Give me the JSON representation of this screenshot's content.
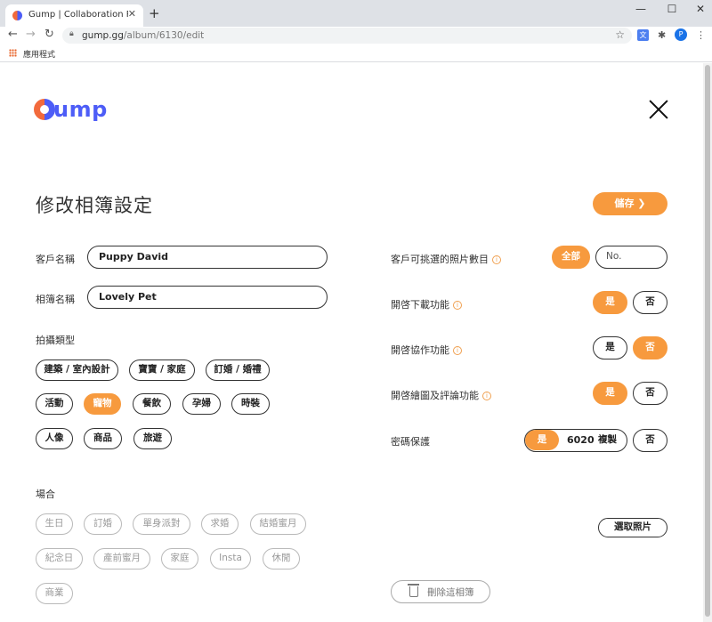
{
  "browser": {
    "tab_title": "Gump | Collaboration Platform",
    "tab_close": "✕",
    "new_tab": "+",
    "url_host": "gump.gg",
    "url_path": "/album/6130/edit",
    "bookmarks_apps_label": "應用程式",
    "profile_initial": "P",
    "translate_glyph": "文",
    "min_glyph": "—",
    "max_glyph": "☐",
    "close_glyph": "✕"
  },
  "header": {
    "logo_text": "ump",
    "title": "修改相簿設定",
    "save_label": "儲存 ❯"
  },
  "form": {
    "client_name_label": "客戶名稱",
    "client_name_value": "Puppy David",
    "album_name_label": "相簿名稱",
    "album_name_value": "Lovely Pet",
    "shoot_type_label": "拍攝類型",
    "shoot_types": [
      "建築 / 室內設計",
      "寶寶 / 家庭",
      "訂婚 / 婚禮",
      "活動",
      "寵物",
      "餐飲",
      "孕婦",
      "時裝",
      "人像",
      "商品",
      "旅遊"
    ],
    "selected_shoot_type": "寵物",
    "occasion_label": "場合",
    "occasions": [
      "生日",
      "訂婚",
      "單身派對",
      "求婚",
      "結婚蜜月",
      "紀念日",
      "產前蜜月",
      "家庭",
      "Insta",
      "休閒",
      "商業"
    ]
  },
  "settings": {
    "photo_count_label": "客戶可挑選的照片數目",
    "photo_count_all": "全部",
    "photo_count_placeholder": "No.",
    "download_label": "開啓下載功能",
    "collab_label": "開啓協作功能",
    "draw_comment_label": "開啓繪圖及評論功能",
    "password_label": "密碼保護",
    "yes": "是",
    "no": "否",
    "password_code": "6020",
    "copy_label": "複製",
    "select_photos_label": "選取照片",
    "delete_album_label": "刪除這相簿",
    "info_glyph": "i"
  },
  "colors": {
    "accent": "#f79a3e",
    "brand_blue": "#4d5df7",
    "brand_orange": "#f26a3c"
  }
}
